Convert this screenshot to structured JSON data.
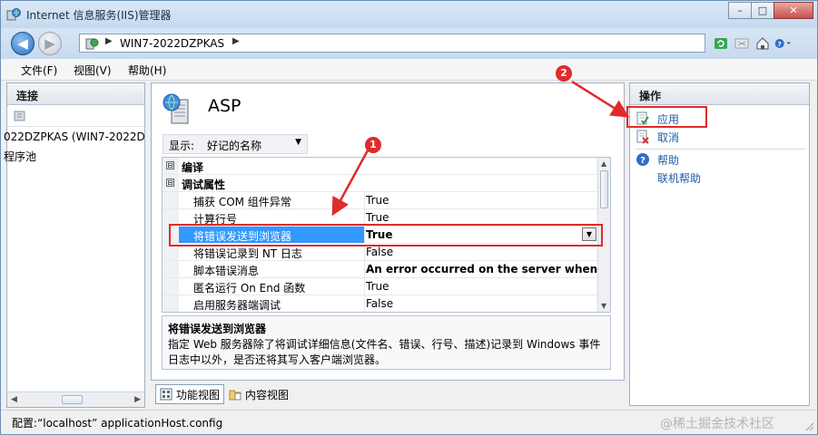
{
  "window": {
    "title": "Internet 信息服务(IIS)管理器",
    "icon": "iis-manager-icon",
    "controls": {
      "minimize": "–",
      "maximize": "□",
      "close": "✕"
    }
  },
  "address": {
    "root_sep": "▶",
    "crumb": "WIN7-2022DZPKAS",
    "crumb_sep": "▶"
  },
  "menu": [
    "文件(F)",
    "视图(V)",
    "帮助(H)"
  ],
  "connections": {
    "header": "连接",
    "items": [
      "022DZPKAS (WIN7-2022D",
      "程序池"
    ]
  },
  "feature": {
    "title": "ASP",
    "display_label": "显示:",
    "display_value": "好记的名称",
    "grid": {
      "rows": [
        {
          "kind": "category",
          "expander": "⊟",
          "label": "编译"
        },
        {
          "kind": "category",
          "expander": "⊟",
          "label": "调试属性"
        },
        {
          "kind": "prop",
          "name": "捕获 COM 组件异常",
          "value": "True"
        },
        {
          "kind": "prop",
          "name": "计算行号",
          "value": "True"
        },
        {
          "kind": "prop",
          "name": "将错误发送到浏览器",
          "value": "True",
          "selected": true
        },
        {
          "kind": "prop",
          "name": "将错误记录到 NT 日志",
          "value": "False"
        },
        {
          "kind": "prop",
          "name": "脚本错误消息",
          "value": "An error occurred on the server when pro",
          "bold": true
        },
        {
          "kind": "prop",
          "name": "匿名运行 On End 函数",
          "value": "True"
        },
        {
          "kind": "prop",
          "name": "启用服务器端调试",
          "value": "False"
        }
      ]
    },
    "description": {
      "title": "将错误发送到浏览器",
      "text": "指定 Web 服务器除了将调试详细信息(文件名、错误、行号、描述)记录到 Windows 事件日志中以外，是否还将其写入客户端浏览器。"
    },
    "tabs": [
      "功能视图",
      "内容视图"
    ]
  },
  "actions": {
    "header": "操作",
    "items": [
      {
        "label": "应用",
        "icon": "apply-icon"
      },
      {
        "label": "取消",
        "icon": "cancel-icon"
      },
      {
        "label": "帮助",
        "icon": "help-icon"
      },
      {
        "label": "联机帮助",
        "icon": ""
      }
    ]
  },
  "status": {
    "text": "配置:“localhost” applicationHost.config",
    "watermark": "@稀土掘金技术社区"
  },
  "annotations": [
    "1",
    "2"
  ],
  "colors": {
    "accent": "#3399ff",
    "annotation": "#e02b2b",
    "link": "#1f5ba8"
  }
}
